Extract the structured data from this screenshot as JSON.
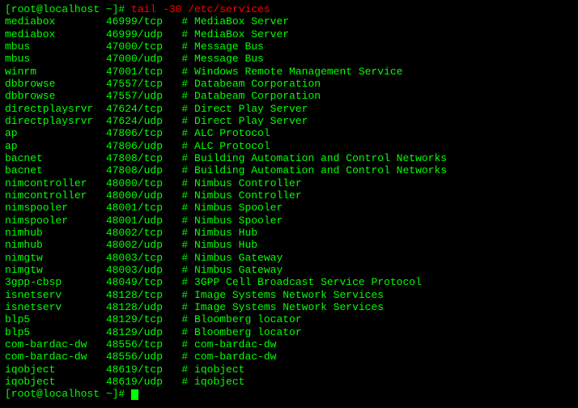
{
  "terminal": {
    "prompt_start": "[root@localhost ~]# ",
    "command": "tail -30 /etc/services",
    "prompt_end": "[root@localhost ~]# ",
    "lines": [
      {
        "name": "mediabox",
        "port": "46999/tcp",
        "comment": "# MediaBox Server"
      },
      {
        "name": "mediabox",
        "port": "46999/udp",
        "comment": "# MediaBox Server"
      },
      {
        "name": "mbus",
        "port": "47000/tcp",
        "comment": "# Message Bus"
      },
      {
        "name": "mbus",
        "port": "47000/udp",
        "comment": "# Message Bus"
      },
      {
        "name": "winrm",
        "port": "47001/tcp",
        "comment": "# Windows Remote Management Service"
      },
      {
        "name": "dbbrowse",
        "port": "47557/tcp",
        "comment": "# Databeam Corporation"
      },
      {
        "name": "dbbrowse",
        "port": "47557/udp",
        "comment": "# Databeam Corporation"
      },
      {
        "name": "directplaysrvr",
        "port": "47624/tcp",
        "comment": "# Direct Play Server"
      },
      {
        "name": "directplaysrvr",
        "port": "47624/udp",
        "comment": "# Direct Play Server"
      },
      {
        "name": "ap",
        "port": "47806/tcp",
        "comment": "# ALC Protocol"
      },
      {
        "name": "ap",
        "port": "47806/udp",
        "comment": "# ALC Protocol"
      },
      {
        "name": "bacnet",
        "port": "47808/tcp",
        "comment": "# Building Automation and Control Networks"
      },
      {
        "name": "bacnet",
        "port": "47808/udp",
        "comment": "# Building Automation and Control Networks"
      },
      {
        "name": "nimcontroller",
        "port": "48000/tcp",
        "comment": "# Nimbus Controller"
      },
      {
        "name": "nimcontroller",
        "port": "48000/udp",
        "comment": "# Nimbus Controller"
      },
      {
        "name": "nimspooler",
        "port": "48001/tcp",
        "comment": "# Nimbus Spooler"
      },
      {
        "name": "nimspooler",
        "port": "48001/udp",
        "comment": "# Nimbus Spooler"
      },
      {
        "name": "nimhub",
        "port": "48002/tcp",
        "comment": "# Nimbus Hub"
      },
      {
        "name": "nimhub",
        "port": "48002/udp",
        "comment": "# Nimbus Hub"
      },
      {
        "name": "nimgtw",
        "port": "48003/tcp",
        "comment": "# Nimbus Gateway"
      },
      {
        "name": "nimgtw",
        "port": "48003/udp",
        "comment": "# Nimbus Gateway"
      },
      {
        "name": "3gpp-cbsp",
        "port": "48049/tcp",
        "comment": "# 3GPP Cell Broadcast Service Protocol"
      },
      {
        "name": "isnetserv",
        "port": "48128/tcp",
        "comment": "# Image Systems Network Services"
      },
      {
        "name": "isnetserv",
        "port": "48128/udp",
        "comment": "# Image Systems Network Services"
      },
      {
        "name": "blp5",
        "port": "48129/tcp",
        "comment": "# Bloomberg locator"
      },
      {
        "name": "blp5",
        "port": "48129/udp",
        "comment": "# Bloomberg locator"
      },
      {
        "name": "com-bardac-dw",
        "port": "48556/tcp",
        "comment": "# com-bardac-dw"
      },
      {
        "name": "com-bardac-dw",
        "port": "48556/udp",
        "comment": "# com-bardac-dw"
      },
      {
        "name": "iqobject",
        "port": "48619/tcp",
        "comment": "# iqobject"
      },
      {
        "name": "iqobject",
        "port": "48619/udp",
        "comment": "# iqobject"
      }
    ]
  }
}
